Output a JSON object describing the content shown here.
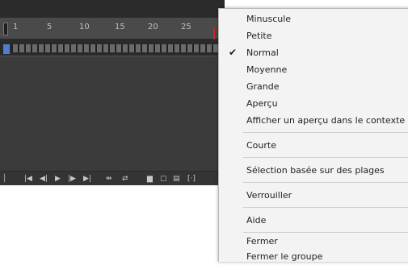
{
  "timeline": {
    "ruler_ticks": [
      "1",
      "5",
      "10",
      "15",
      "20",
      "25"
    ],
    "bottom_controls": [
      {
        "name": "frame-divider-icon",
        "glyph": "│"
      },
      {
        "name": "first-frame-icon",
        "glyph": "|◀"
      },
      {
        "name": "step-back-icon",
        "glyph": "◀|"
      },
      {
        "name": "play-icon",
        "glyph": "▶"
      },
      {
        "name": "step-forward-icon",
        "glyph": "|▶"
      },
      {
        "name": "last-frame-icon",
        "glyph": "▶|"
      },
      {
        "name": "center-frame-icon",
        "glyph": "⇹"
      },
      {
        "name": "loop-icon",
        "glyph": "⇄"
      },
      {
        "name": "onion-skin-icon",
        "glyph": "▆"
      },
      {
        "name": "onion-outline-icon",
        "glyph": "▢"
      },
      {
        "name": "edit-multiple-icon",
        "glyph": "▤"
      },
      {
        "name": "modify-markers-icon",
        "glyph": "[·]"
      }
    ]
  },
  "menu": {
    "items": [
      {
        "label": "Minuscule",
        "checked": false
      },
      {
        "label": "Petite",
        "checked": false
      },
      {
        "label": "Normal",
        "checked": true
      },
      {
        "label": "Moyenne",
        "checked": false
      },
      {
        "label": "Grande",
        "checked": false
      },
      {
        "label": "Aperçu",
        "checked": false
      },
      {
        "label": "Afficher un aperçu dans le contexte",
        "checked": false
      },
      {
        "label": "Courte",
        "checked": false
      },
      {
        "label": "Sélection basée sur des plages",
        "checked": false
      },
      {
        "label": "Verrouiller",
        "checked": false
      },
      {
        "label": "Aide",
        "checked": false
      },
      {
        "label": "Fermer",
        "checked": false
      },
      {
        "label": "Fermer le groupe",
        "checked": false
      }
    ],
    "check_glyph": "✔"
  }
}
